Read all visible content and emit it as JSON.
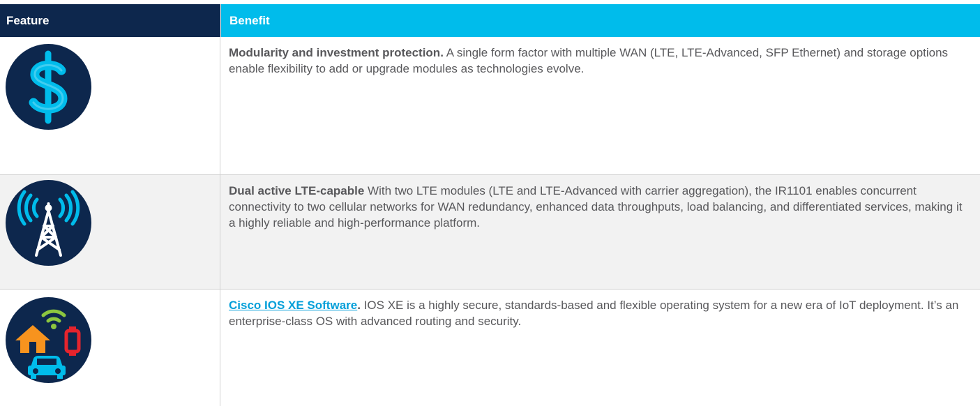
{
  "header": {
    "feature": "Feature",
    "benefit": "Benefit"
  },
  "rows": [
    {
      "icon": "dollar-icon",
      "title": "Modularity and investment protection.",
      "text": " A single form factor with multiple WAN (LTE, LTE-Advanced, SFP Ethernet) and storage options enable flexibility to add or upgrade modules as technologies evolve."
    },
    {
      "icon": "cell-tower-icon",
      "title": "Dual active LTE-capable",
      "text": " With two LTE modules (LTE and LTE-Advanced with carrier aggregation), the IR1101 enables concurrent connectivity to two cellular networks for WAN redundancy, enhanced data throughputs, load balancing, and differentiated services, making it a highly reliable and high-performance platform."
    },
    {
      "icon": "iot-devices-icon",
      "title": "Cisco IOS XE Software",
      "title_suffix": ".",
      "text": " IOS XE is a highly secure, standards-based and flexible operating system for a new era of IoT deployment. It’s an enterprise-class OS with advanced routing and security."
    }
  ],
  "colors": {
    "header_dark": "#0d274d",
    "header_cyan": "#00bceb",
    "icon_circle": "#0d274d",
    "dollar": "#00bceb",
    "link": "#049fd9"
  }
}
